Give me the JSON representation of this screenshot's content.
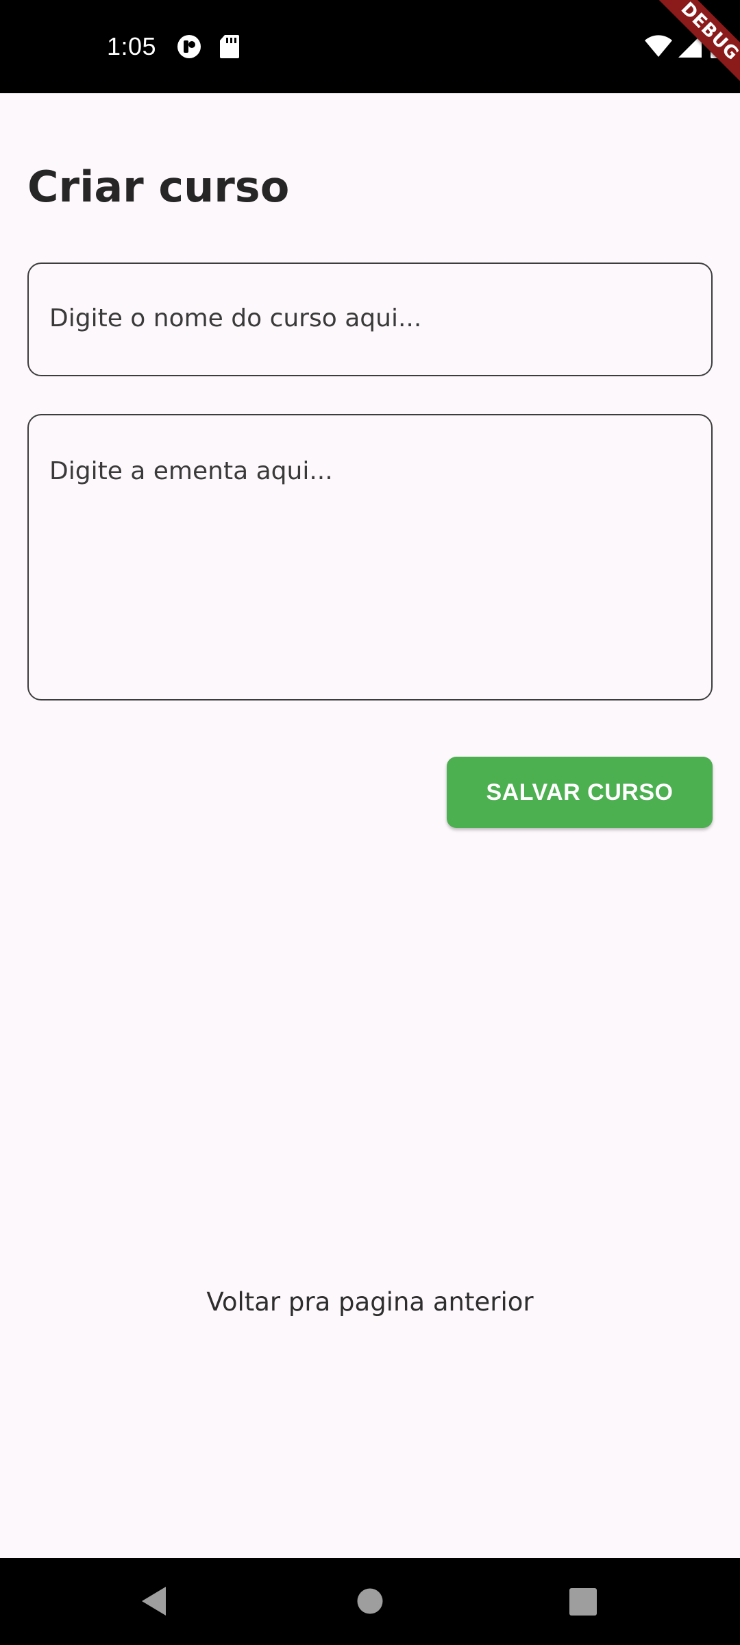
{
  "status_bar": {
    "time": "1:05",
    "debug_label": "DEBUG",
    "icons": [
      "notification-icon",
      "sd-card-icon",
      "wifi-icon",
      "signal-icon",
      "battery-icon"
    ]
  },
  "page": {
    "title": "Criar curso"
  },
  "form": {
    "course_name_placeholder": "Digite o nome do curso aqui...",
    "ementa_placeholder": "Digite a ementa aqui...",
    "save_label": "SALVAR CURSO"
  },
  "footer": {
    "back_label": "Voltar pra pagina anterior"
  },
  "nav_bar": {
    "icons": [
      "back-icon",
      "home-icon",
      "recents-icon"
    ]
  },
  "colors": {
    "background": "#fdf8fc",
    "accent": "#4caf50",
    "debug_ribbon": "#8b1a1a",
    "system_bars": "#000000"
  }
}
